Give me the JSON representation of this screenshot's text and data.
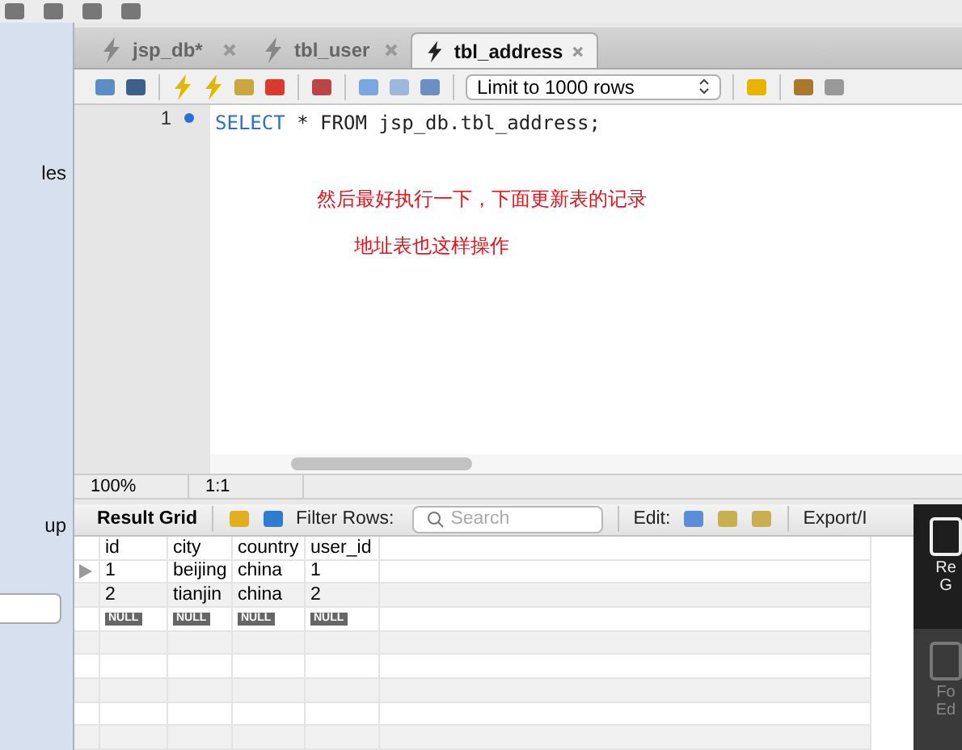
{
  "sidebar": {
    "texts": [
      "les",
      "up"
    ]
  },
  "tabs": [
    {
      "label": "jsp_db*",
      "selected": false
    },
    {
      "label": "tbl_user",
      "selected": false
    },
    {
      "label": "tbl_address",
      "selected": true
    }
  ],
  "toolbar": {
    "limit": "Limit to 1000 rows"
  },
  "editor": {
    "lines": [
      {
        "number": "1",
        "code": "SELECT * FROM jsp_db.tbl_address;"
      }
    ],
    "notes": [
      "然后最好执行一下，下面更新表的记录",
      "地址表也这样操作"
    ],
    "zoom": "100%",
    "position": "1:1"
  },
  "result": {
    "title": "Result Grid",
    "filter_label": "Filter Rows:",
    "search": {
      "placeholder": "Search"
    },
    "edit_label": "Edit:",
    "export_label": "Export/I",
    "columns": [
      "id",
      "city",
      "country",
      "user_id"
    ],
    "rows": [
      {
        "selected": true,
        "cells": [
          "1",
          "beijing",
          "china",
          "1"
        ]
      },
      {
        "selected": false,
        "cells": [
          "2",
          "tianjin",
          "china",
          "2"
        ]
      },
      {
        "selected": false,
        "cells": [
          "NULL",
          "NULL",
          "NULL",
          "NULL"
        ],
        "kind": "null"
      }
    ]
  },
  "side_panel": [
    {
      "label": "Re G",
      "selected": true
    },
    {
      "label": "Fo Ed",
      "selected": false
    }
  ]
}
